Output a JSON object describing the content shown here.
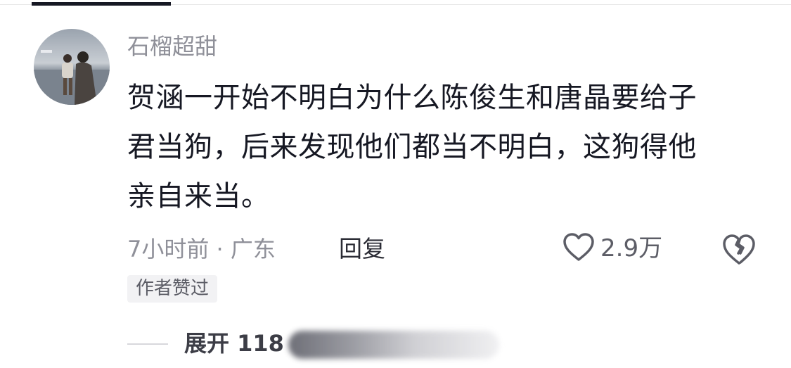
{
  "comment": {
    "username": "石榴超甜",
    "lines": [
      "贺涵一开始不明白为什么陈俊生和唐晶要给子",
      "君当狗，后来发现他们都当不明白，这狗得他",
      "亲自来当。"
    ],
    "meta": "7小时前 · 广东",
    "reply_label": "回复",
    "like_count": "2.9万",
    "author_liked_badge": "作者赞过",
    "expand_label": "展开 118"
  },
  "icons": {
    "like": "heart-outline-icon",
    "dislike": "broken-heart-icon"
  },
  "colors": {
    "primary_text": "#161823",
    "secondary_text": "#8f9099",
    "badge_bg": "#f2f2f4"
  }
}
